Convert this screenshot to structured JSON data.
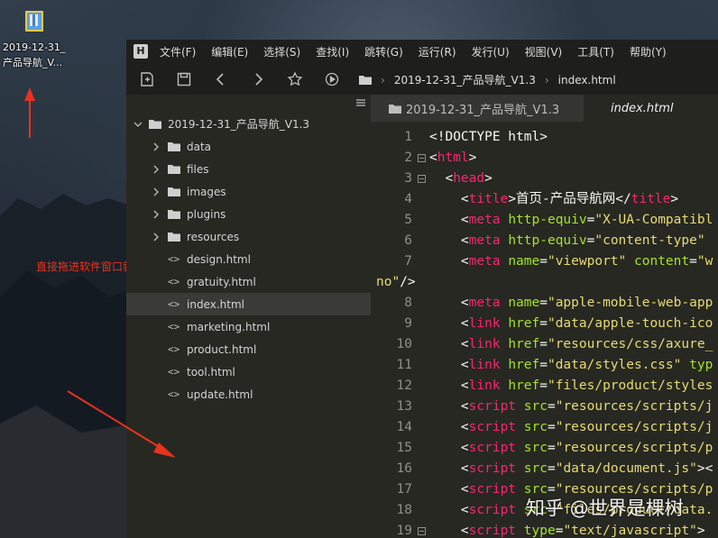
{
  "desktop": {
    "icon_label_line1": "2019-12-31_",
    "icon_label_line2": "产品导航_V..."
  },
  "annotation": {
    "text": "直接拖进软件窗口就可以了"
  },
  "menubar": {
    "logo": "H",
    "items": [
      "文件(F)",
      "编辑(E)",
      "选择(S)",
      "查找(I)",
      "跳转(G)",
      "运行(R)",
      "发行(U)",
      "视图(V)",
      "工具(T)",
      "帮助(Y)"
    ]
  },
  "toolbar": {
    "icons": [
      "new-file-icon",
      "save-icon",
      "back-icon",
      "forward-icon",
      "star-icon",
      "run-icon"
    ],
    "breadcrumb": {
      "folder": "2019-12-31_产品导航_V1.3",
      "file": "index.html"
    }
  },
  "sidebar": {
    "root": "2019-12-31_产品导航_V1.3",
    "folders": [
      "data",
      "files",
      "images",
      "plugins",
      "resources"
    ],
    "files": [
      "design.html",
      "gratuity.html",
      "index.html",
      "marketing.html",
      "product.html",
      "tool.html",
      "update.html"
    ],
    "active_file": "index.html"
  },
  "tabs": {
    "tab1": "2019-12-31_产品导航_V1.3",
    "tab2": "index.html"
  },
  "editor": {
    "lines": [
      {
        "n": "1",
        "fold": false,
        "parts": [
          [
            "p",
            "<!DOCTYPE html>"
          ]
        ]
      },
      {
        "n": "2",
        "fold": true,
        "parts": [
          [
            "p",
            "<"
          ],
          [
            "t",
            "html"
          ],
          [
            "p",
            ">"
          ]
        ]
      },
      {
        "n": "3",
        "fold": true,
        "parts": [
          [
            "p",
            "  <"
          ],
          [
            "t",
            "head"
          ],
          [
            "p",
            ">"
          ]
        ]
      },
      {
        "n": "4",
        "fold": false,
        "parts": [
          [
            "p",
            "    <"
          ],
          [
            "t",
            "title"
          ],
          [
            "p",
            ">首页-产品导航网</"
          ],
          [
            "t",
            "title"
          ],
          [
            "p",
            ">"
          ]
        ]
      },
      {
        "n": "5",
        "fold": false,
        "parts": [
          [
            "p",
            "    <"
          ],
          [
            "t",
            "meta"
          ],
          [
            "p",
            " "
          ],
          [
            "a",
            "http-equiv"
          ],
          [
            "p",
            "="
          ],
          [
            "s",
            "\"X-UA-Compatibl"
          ]
        ]
      },
      {
        "n": "6",
        "fold": false,
        "parts": [
          [
            "p",
            "    <"
          ],
          [
            "t",
            "meta"
          ],
          [
            "p",
            " "
          ],
          [
            "a",
            "http-equiv"
          ],
          [
            "p",
            "="
          ],
          [
            "s",
            "\"content-type\""
          ]
        ]
      },
      {
        "n": "7",
        "fold": false,
        "parts": [
          [
            "p",
            "    <"
          ],
          [
            "t",
            "meta"
          ],
          [
            "p",
            " "
          ],
          [
            "a",
            "name"
          ],
          [
            "p",
            "="
          ],
          [
            "s",
            "\"viewport\""
          ],
          [
            "p",
            " "
          ],
          [
            "a",
            "content"
          ],
          [
            "p",
            "="
          ],
          [
            "s",
            "\"w"
          ]
        ]
      },
      {
        "n": "",
        "fold": false,
        "parts": [
          [
            "s",
            "no\""
          ],
          [
            "p",
            "/>"
          ]
        ],
        "wrap": true
      },
      {
        "n": "8",
        "fold": false,
        "parts": [
          [
            "p",
            "    <"
          ],
          [
            "t",
            "meta"
          ],
          [
            "p",
            " "
          ],
          [
            "a",
            "name"
          ],
          [
            "p",
            "="
          ],
          [
            "s",
            "\"apple-mobile-web-app"
          ]
        ]
      },
      {
        "n": "9",
        "fold": false,
        "parts": [
          [
            "p",
            "    <"
          ],
          [
            "t",
            "link"
          ],
          [
            "p",
            " "
          ],
          [
            "a",
            "href"
          ],
          [
            "p",
            "="
          ],
          [
            "s",
            "\"data/apple-touch-ico"
          ]
        ]
      },
      {
        "n": "10",
        "fold": false,
        "parts": [
          [
            "p",
            "    <"
          ],
          [
            "t",
            "link"
          ],
          [
            "p",
            " "
          ],
          [
            "a",
            "href"
          ],
          [
            "p",
            "="
          ],
          [
            "s",
            "\"resources/css/axure_"
          ]
        ]
      },
      {
        "n": "11",
        "fold": false,
        "parts": [
          [
            "p",
            "    <"
          ],
          [
            "t",
            "link"
          ],
          [
            "p",
            " "
          ],
          [
            "a",
            "href"
          ],
          [
            "p",
            "="
          ],
          [
            "s",
            "\"data/styles.css\""
          ],
          [
            "p",
            " "
          ],
          [
            "a",
            "typ"
          ]
        ]
      },
      {
        "n": "12",
        "fold": false,
        "parts": [
          [
            "p",
            "    <"
          ],
          [
            "t",
            "link"
          ],
          [
            "p",
            " "
          ],
          [
            "a",
            "href"
          ],
          [
            "p",
            "="
          ],
          [
            "s",
            "\"files/product/styles"
          ]
        ]
      },
      {
        "n": "13",
        "fold": false,
        "parts": [
          [
            "p",
            "    <"
          ],
          [
            "t",
            "script"
          ],
          [
            "p",
            " "
          ],
          [
            "a",
            "src"
          ],
          [
            "p",
            "="
          ],
          [
            "s",
            "\"resources/scripts/j"
          ]
        ]
      },
      {
        "n": "14",
        "fold": false,
        "parts": [
          [
            "p",
            "    <"
          ],
          [
            "t",
            "script"
          ],
          [
            "p",
            " "
          ],
          [
            "a",
            "src"
          ],
          [
            "p",
            "="
          ],
          [
            "s",
            "\"resources/scripts/j"
          ]
        ]
      },
      {
        "n": "15",
        "fold": false,
        "parts": [
          [
            "p",
            "    <"
          ],
          [
            "t",
            "script"
          ],
          [
            "p",
            " "
          ],
          [
            "a",
            "src"
          ],
          [
            "p",
            "="
          ],
          [
            "s",
            "\"resources/scripts/p"
          ]
        ]
      },
      {
        "n": "16",
        "fold": false,
        "parts": [
          [
            "p",
            "    <"
          ],
          [
            "t",
            "script"
          ],
          [
            "p",
            " "
          ],
          [
            "a",
            "src"
          ],
          [
            "p",
            "="
          ],
          [
            "s",
            "\"data/document.js\""
          ],
          [
            "p",
            "><"
          ]
        ]
      },
      {
        "n": "17",
        "fold": false,
        "parts": [
          [
            "p",
            "    <"
          ],
          [
            "t",
            "script"
          ],
          [
            "p",
            " "
          ],
          [
            "a",
            "src"
          ],
          [
            "p",
            "="
          ],
          [
            "s",
            "\"resources/scripts/p"
          ]
        ]
      },
      {
        "n": "18",
        "fold": false,
        "parts": [
          [
            "p",
            "    <"
          ],
          [
            "t",
            "script"
          ],
          [
            "p",
            " "
          ],
          [
            "a",
            "src"
          ],
          [
            "p",
            "="
          ],
          [
            "s",
            "\"files/product/data."
          ]
        ]
      },
      {
        "n": "19",
        "fold": true,
        "parts": [
          [
            "p",
            "    <"
          ],
          [
            "t",
            "script"
          ],
          [
            "p",
            " "
          ],
          [
            "a",
            "type"
          ],
          [
            "p",
            "="
          ],
          [
            "s",
            "\"text/javascript\""
          ],
          [
            "p",
            ">"
          ]
        ]
      }
    ]
  },
  "watermark": {
    "text": "知乎 @世界是棵树"
  },
  "colors": {
    "tag": "#f92672",
    "attr": "#a6e22e",
    "string": "#e6db74",
    "text": "#f8f8f2",
    "background": "#272822",
    "annotation": "#e8331f"
  }
}
